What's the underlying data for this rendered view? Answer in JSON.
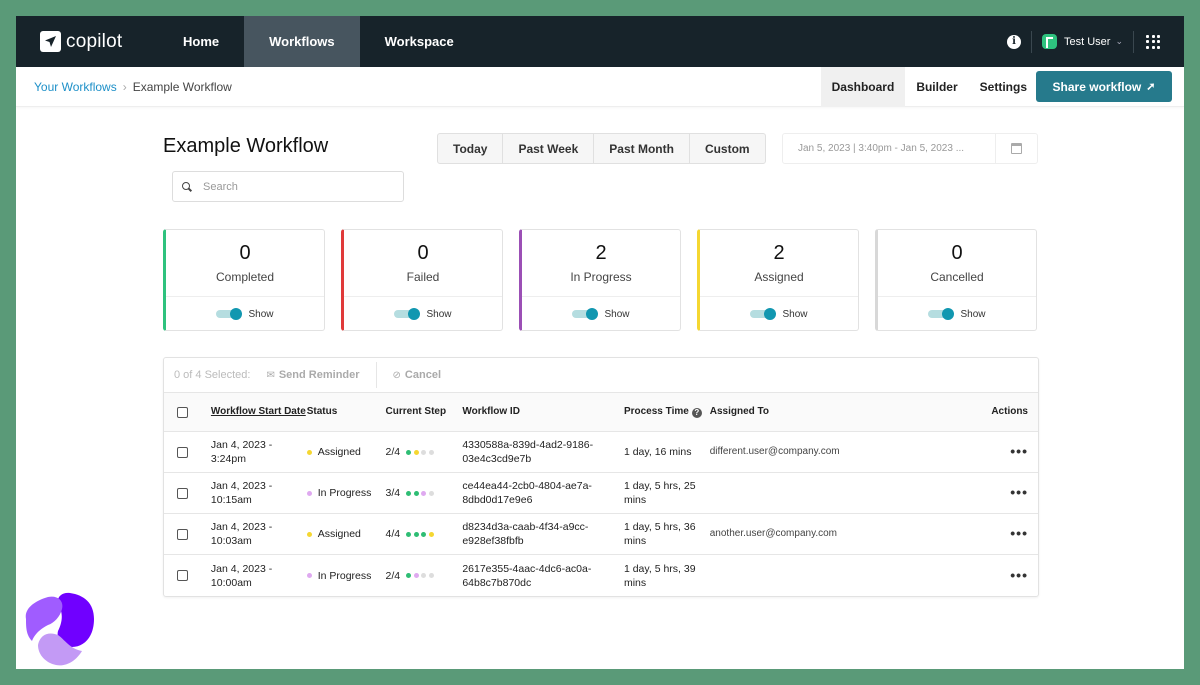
{
  "app": {
    "name": "copilot"
  },
  "nav": {
    "items": [
      {
        "label": "Home",
        "active": false
      },
      {
        "label": "Workflows",
        "active": true
      },
      {
        "label": "Workspace",
        "active": false
      }
    ],
    "user": {
      "name": "Test User",
      "badge_color": "#2ec27e"
    }
  },
  "breadcrumb": {
    "parent": "Your Workflows",
    "current": "Example Workflow"
  },
  "subtabs": [
    {
      "label": "Dashboard",
      "active": true
    },
    {
      "label": "Builder",
      "active": false
    },
    {
      "label": "Settings",
      "active": false
    }
  ],
  "share_button": {
    "label": "Share workflow",
    "color": "#267a8c"
  },
  "page": {
    "title": "Example Workflow"
  },
  "search": {
    "placeholder": "Search",
    "value": ""
  },
  "range_options": [
    "Today",
    "Past Week",
    "Past Month",
    "Custom"
  ],
  "date_range": {
    "value": "Jan 5, 2023 | 3:40pm - Jan 5, 2023 ..."
  },
  "stats": [
    {
      "count": "0",
      "label": "Completed",
      "color": "#2ec27e",
      "toggle_label": "Show",
      "toggle_on": true
    },
    {
      "count": "0",
      "label": "Failed",
      "color": "#e03a3a",
      "toggle_label": "Show",
      "toggle_on": true
    },
    {
      "count": "2",
      "label": "In Progress",
      "color": "#9b4fb5",
      "toggle_label": "Show",
      "toggle_on": true
    },
    {
      "count": "2",
      "label": "Assigned",
      "color": "#f5d731",
      "toggle_label": "Show",
      "toggle_on": true
    },
    {
      "count": "0",
      "label": "Cancelled",
      "color": "#d8d8d8",
      "toggle_label": "Show",
      "toggle_on": true
    }
  ],
  "table": {
    "toolbar": {
      "selected": "0 of 4 Selected:",
      "send_reminder": "Send Reminder",
      "cancel": "Cancel"
    },
    "columns": {
      "start_date": "Workflow Start Date",
      "status": "Status",
      "current_step": "Current Step",
      "workflow_id": "Workflow ID",
      "process_time": "Process Time",
      "assigned_to": "Assigned To",
      "actions": "Actions"
    },
    "rows": [
      {
        "date": "Jan 4, 2023 - 3:24pm",
        "status": "Assigned",
        "status_color": "#f5d731",
        "step": "2/4",
        "step_dots": [
          "#2ebd74",
          "#f5d731",
          "#dddddd",
          "#dddddd"
        ],
        "id": "4330588a-839d-4ad2-9186-03e4c3cd9e7b",
        "time": "1 day, 16 mins",
        "assigned": "different.user@company.com"
      },
      {
        "date": "Jan 4, 2023 - 10:15am",
        "status": "In Progress",
        "status_color": "#dfa9f0",
        "step": "3/4",
        "step_dots": [
          "#2ebd74",
          "#2ebd74",
          "#dfa9f0",
          "#dddddd"
        ],
        "id": "ce44ea44-2cb0-4804-ae7a-8dbd0d17e9e6",
        "time": "1 day, 5 hrs, 25 mins",
        "assigned": ""
      },
      {
        "date": "Jan 4, 2023 - 10:03am",
        "status": "Assigned",
        "status_color": "#f5d731",
        "step": "4/4",
        "step_dots": [
          "#2ebd74",
          "#2ebd74",
          "#2ebd74",
          "#f5d731"
        ],
        "id": "d8234d3a-caab-4f34-a9cc-e928ef38fbfb",
        "time": "1 day, 5 hrs, 36 mins",
        "assigned": "another.user@company.com"
      },
      {
        "date": "Jan 4, 2023 - 10:00am",
        "status": "In Progress",
        "status_color": "#dfa9f0",
        "step": "2/4",
        "step_dots": [
          "#2ebd74",
          "#dfa9f0",
          "#dddddd",
          "#dddddd"
        ],
        "id": "2617e355-4aac-4dc6-ac0a-64b8c7b870dc",
        "time": "1 day, 5 hrs, 39 mins",
        "assigned": ""
      }
    ]
  }
}
